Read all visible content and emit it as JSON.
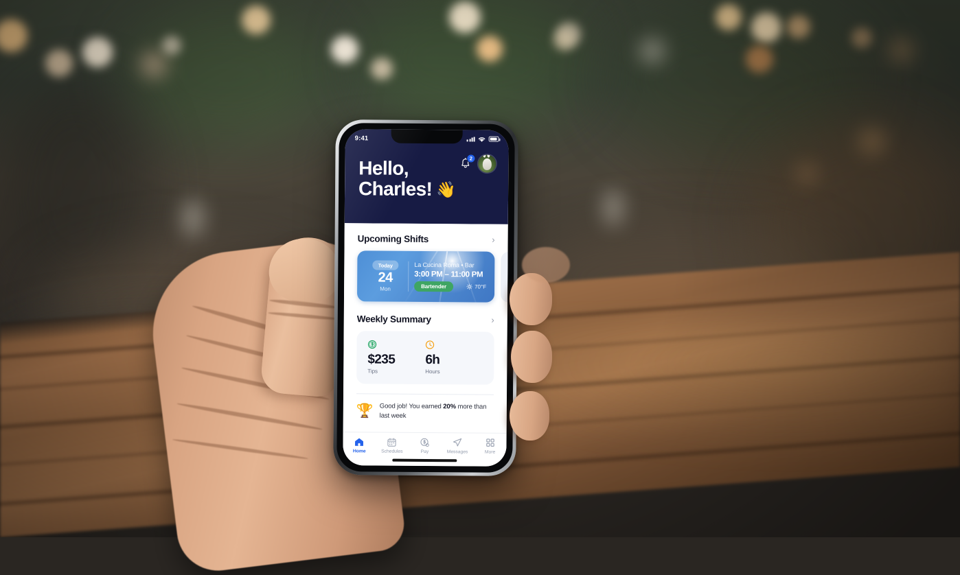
{
  "scene": {
    "description": "blurred outdoor cafe at dusk with warm bokeh string lights",
    "foreground": "hand holding smartphone over wooden table"
  },
  "phone": {
    "statusbar": {
      "time": "9:41",
      "signal_icon": "cellular-signal-icon",
      "wifi_icon": "wifi-icon",
      "battery_icon": "battery-icon"
    },
    "header": {
      "greeting": "Hello,\nCharles!",
      "wave_emoji": "👋",
      "bell_icon": "notification-bell-icon",
      "notification_count": "2",
      "avatar_label": "profile-avatar",
      "bg_color": "#171b44"
    },
    "shifts": {
      "title": "Upcoming Shifts",
      "chevron": "›",
      "card": {
        "badge": "Today",
        "day_number": "24",
        "day_name": "Mon",
        "venue": "La Cucina Roma  •  Bar",
        "times": "3:00 PM – 11:00 PM",
        "role": "Bartender",
        "role_color": "#3fa563",
        "weather_icon": "sun-icon",
        "weather": "70°F"
      }
    },
    "summary": {
      "title": "Weekly Summary",
      "chevron": "›",
      "stats": [
        {
          "icon": "dollar-circle-icon",
          "value": "$235",
          "label": "Tips",
          "color": "#1aa35c"
        },
        {
          "icon": "clock-icon",
          "value": "6h",
          "label": "Hours",
          "color": "#f59e0b"
        }
      ],
      "achievement": {
        "icon": "trophy-icon",
        "text_before": "Good job! You earned ",
        "highlight": "20%",
        "text_after": " more than last week"
      }
    },
    "tabbar": {
      "items": [
        {
          "icon": "home-icon",
          "label": "Home",
          "active": true
        },
        {
          "icon": "calendar-icon",
          "label": "Schedules",
          "active": false
        },
        {
          "icon": "pay-icon",
          "label": "Pay",
          "active": false
        },
        {
          "icon": "send-icon",
          "label": "Messages",
          "active": false
        },
        {
          "icon": "grid-icon",
          "label": "More",
          "active": false
        }
      ],
      "active_color": "#2563eb",
      "inactive_color": "#98a0b0"
    }
  }
}
